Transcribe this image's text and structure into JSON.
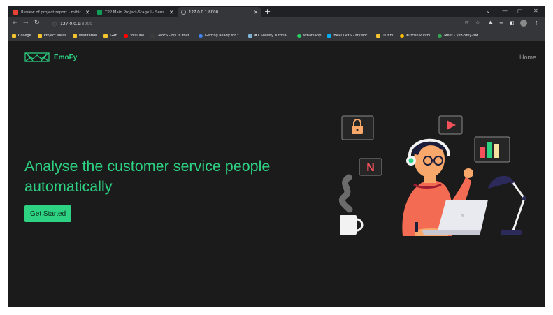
{
  "browser": {
    "tabs": [
      {
        "title": "Review of project report - mihir...",
        "favicon_color": "#ea4335",
        "active": false
      },
      {
        "title": "TPP Main Project-Stage II- Sem ...",
        "favicon_color": "#0f9d58",
        "active": false
      },
      {
        "title": "127.0.0.1:8000",
        "favicon_color": "#9aa0a6",
        "active": true
      }
    ],
    "new_tab": "+",
    "url_host": "127.0.0.1",
    "url_port": ":8000",
    "bookmarks": [
      {
        "label": "College",
        "color": "#f4c430"
      },
      {
        "label": "Project Ideas",
        "color": "#f4c430"
      },
      {
        "label": "Meditation",
        "color": "#f4c430"
      },
      {
        "label": "GRE",
        "color": "#f4c430"
      },
      {
        "label": "YouTube",
        "color": "#ff0000"
      },
      {
        "label": "GeoFS - Fly in Your...",
        "color": "#3b3b3b"
      },
      {
        "label": "Getting Ready for Y...",
        "color": "#4285f4"
      },
      {
        "label": "#1 Solidity Tutorial...",
        "color": "#7fb3d5"
      },
      {
        "label": "WhatsApp",
        "color": "#25d366"
      },
      {
        "label": "BARCLAYS - MyWor...",
        "color": "#00aeef"
      },
      {
        "label": "TOEFL",
        "color": "#f4c430"
      },
      {
        "label": "Kutchu Putchu",
        "color": "#fbbc05"
      },
      {
        "label": "Meet - yez-rduy-fdd",
        "color": "#34a853"
      }
    ]
  },
  "page": {
    "brand": "EmoFy",
    "nav_home": "Home",
    "headline_line1": "Analyse the customer service people",
    "headline_line2": "automatically",
    "cta_label": "Get Started",
    "accent_color": "#2dd283",
    "background_color": "#1b1b1b"
  },
  "illustration": {
    "badge_letter": "N"
  }
}
